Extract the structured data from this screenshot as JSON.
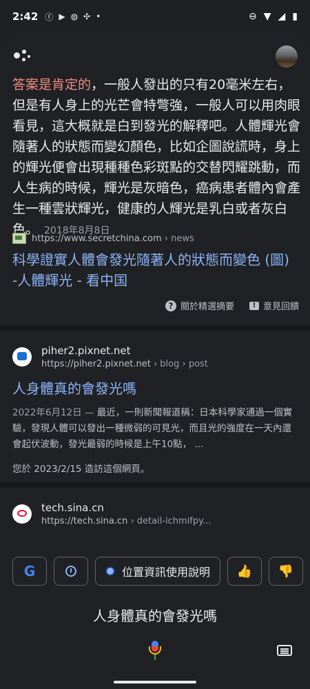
{
  "status_bar": {
    "time": "2:42",
    "apps": [
      "facebook-icon",
      "youtube-icon",
      "line-icon",
      "pinwheel-icon",
      "dot-icon"
    ],
    "right_icons": [
      "dnd-icon",
      "wifi-icon",
      "signal-icon",
      "battery-icon"
    ]
  },
  "answer": {
    "highlight": "答案是肯定的",
    "text": "，一般人發出的只有20毫米左右，但是有人身上的光芒會特彆強，一般人可以用肉眼看見，這大概就是白到發光的解釋吧。人體輝光會隨著人的狀態而變幻顏色，比如企圖說謊時，身上的輝光便會出現種種色彩斑點的交替閃耀跳動，而人生病的時候，輝光是灰暗色，癌病患者體內會產生一種雲狀輝光，健康的人輝光是乳白或者灰白色。",
    "date": "2018年8月8日"
  },
  "featured_source": {
    "url": "https://www.secretchina.com",
    "breadcrumb": "› news",
    "title": "科學證實人體會發光隨著人的狀態而變色 (圖) -人體輝光 - 看中国",
    "about_label": "關於精選摘要",
    "feedback_label": "意見回饋"
  },
  "results": [
    {
      "site_name": "piher2.pixnet.net",
      "url": "https://piher2.pixnet.net",
      "breadcrumb": "› blog › post",
      "title": "人身體真的會發光嗎",
      "date": "2022年6月12日 —",
      "snippet": " 最近，一則新聞報道稱：日本科學家通過一個實驗，發現人體可以發出一種微弱的可見光，而且光的強度在一天內還會起伏波動，發光最弱的時候是上午10點， ...",
      "visited": "您於 2023/2/15 造訪這個網頁。"
    },
    {
      "site_name": "tech.sina.cn",
      "url": "https://tech.sina.cn",
      "breadcrumb": "› detail-ichmifpy..."
    }
  ],
  "chips": {
    "location_label": "位置資訊使用說明"
  },
  "query": "人身體真的會發光嗎"
}
